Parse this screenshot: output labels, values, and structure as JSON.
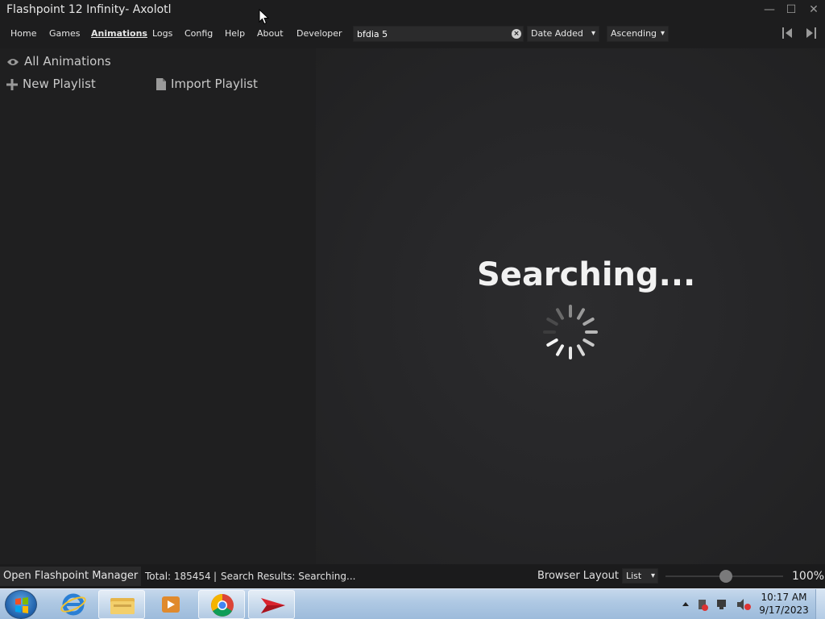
{
  "window": {
    "title": "Flashpoint 12 Infinity- Axolotl",
    "controls": {
      "minimize": "—",
      "maximize": "☐",
      "close": "✕"
    }
  },
  "nav": {
    "items": [
      {
        "label": "Home",
        "active": false
      },
      {
        "label": "Games",
        "active": false
      },
      {
        "label": "Animations",
        "active": true
      },
      {
        "label": "Logs",
        "active": false
      },
      {
        "label": "Config",
        "active": false
      },
      {
        "label": "Help",
        "active": false
      },
      {
        "label": "About",
        "active": false
      },
      {
        "label": "Developer",
        "active": false
      }
    ],
    "search": {
      "value": "bfdia 5",
      "clear_icon": "clear-circle-icon"
    },
    "order_by": {
      "selected": "Date Added"
    },
    "order_dir": {
      "selected": "Ascending"
    }
  },
  "sidebar": {
    "all_label": "All Animations",
    "new_playlist_label": "New Playlist",
    "import_playlist_label": "Import Playlist"
  },
  "main": {
    "status_text": "Searching..."
  },
  "statusbar": {
    "manager_button": "Open Flashpoint Manager",
    "total_text": "Total: 185454",
    "separator": "|",
    "results_text": "Search Results: Searching...",
    "layout_label": "Browser Layout",
    "layout_selected": "List",
    "zoom_text": "100%"
  },
  "taskbar": {
    "clock_time": "10:17 AM",
    "clock_date": "9/17/2023"
  },
  "colors": {
    "background": "#1f1f20",
    "main_bg": "#262628",
    "text": "#e6e6e6",
    "accent_red": "#d9232e"
  }
}
